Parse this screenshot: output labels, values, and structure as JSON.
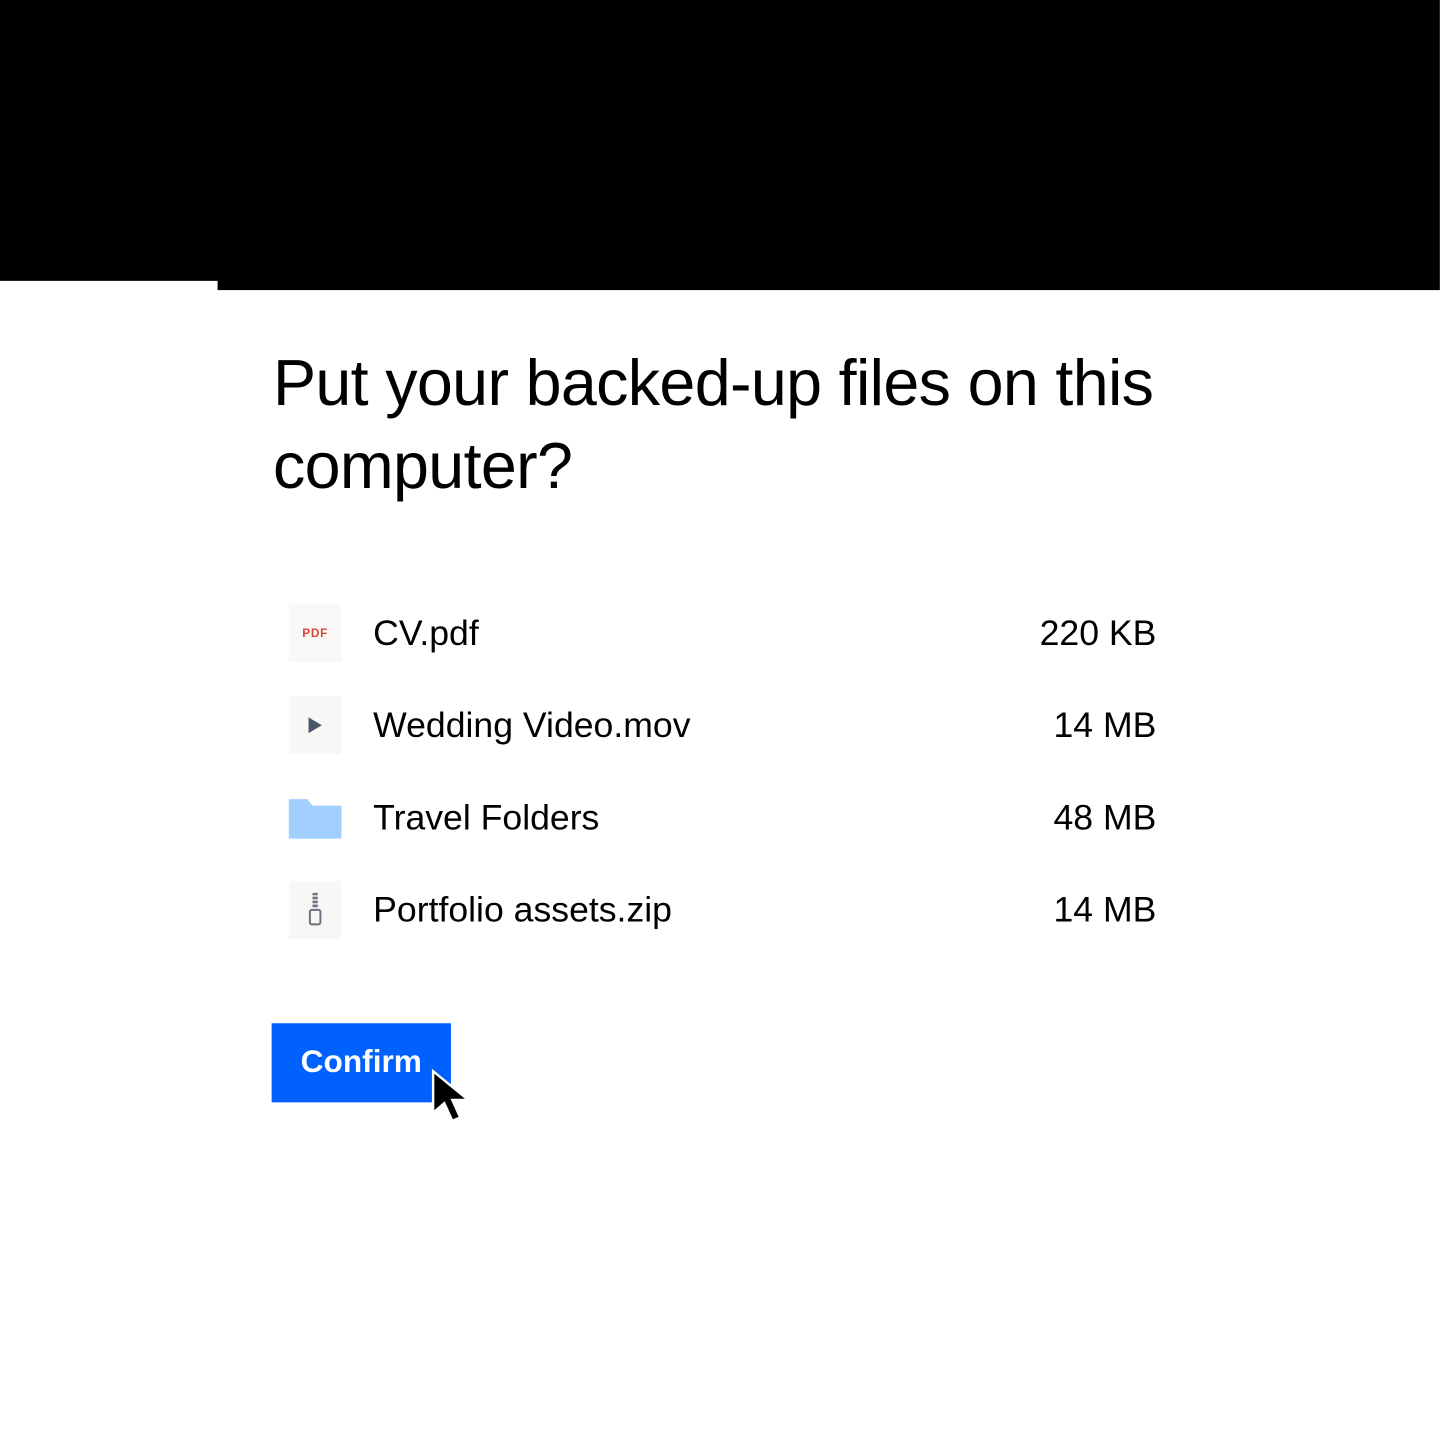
{
  "title": "Put your backed-up files on this computer?",
  "files": [
    {
      "name": "CV.pdf",
      "size": "220 KB",
      "icon": "pdf"
    },
    {
      "name": "Wedding Video.mov",
      "size": "14 MB",
      "icon": "video"
    },
    {
      "name": "Travel Folders",
      "size": "48 MB",
      "icon": "folder"
    },
    {
      "name": "Portfolio assets.zip",
      "size": "14 MB",
      "icon": "zip"
    }
  ],
  "confirm_label": "Confirm",
  "colors": {
    "accent": "#0061fe",
    "folder": "#a1d0ff"
  }
}
